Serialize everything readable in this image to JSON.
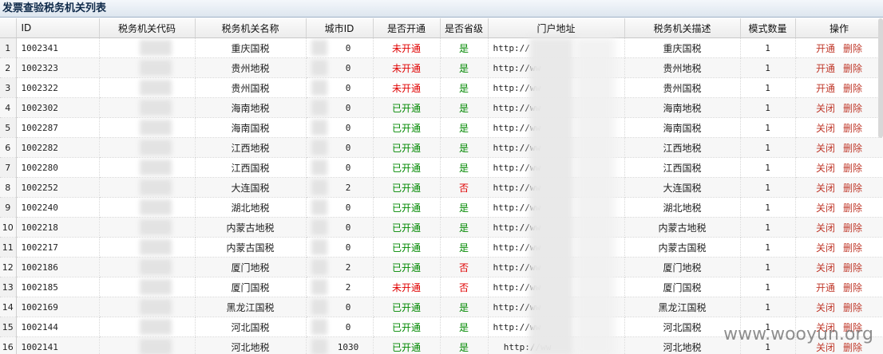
{
  "panel": {
    "title": "发票查验税务机关列表"
  },
  "columns": {
    "id": "ID",
    "code": "税务机关代码",
    "name": "税务机关名称",
    "city_id": "城市ID",
    "enabled": "是否开通",
    "provincial": "是否省级",
    "portal": "门户地址",
    "description": "税务机关描述",
    "mode_count": "模式数量",
    "actions": "操作"
  },
  "labels": {
    "delete": "删除"
  },
  "colors": {
    "not_open": "#e00000",
    "open": "#008800",
    "action": "#c0392b"
  },
  "rows": [
    {
      "no": "1",
      "id": "1002341",
      "code": "",
      "name": "重庆国税",
      "city": "0",
      "enabled": "未开通",
      "prov": "是",
      "url": "http://                  ov    /",
      "desc": "重庆国税",
      "modes": "1",
      "toggle": "开通"
    },
    {
      "no": "2",
      "id": "1002323",
      "code": "",
      "name": "贵州地税",
      "city": "0",
      "enabled": "未开通",
      "prov": "是",
      "url": "http://ww                      .",
      "desc": "贵州地税",
      "modes": "1",
      "toggle": "开通"
    },
    {
      "no": "3",
      "id": "1002322",
      "code": "",
      "name": "贵州国税",
      "city": "0",
      "enabled": "未开通",
      "prov": "是",
      "url": "http://ww                      /",
      "desc": "贵州国税",
      "modes": "1",
      "toggle": "开通"
    },
    {
      "no": "4",
      "id": "1002302",
      "code": "",
      "name": "海南地税",
      "city": "0",
      "enabled": "已开通",
      "prov": "是",
      "url": "http://ww                      e",
      "desc": "海南地税",
      "modes": "1",
      "toggle": "关闭"
    },
    {
      "no": "5",
      "id": "1002287",
      "code": "",
      "name": "海南国税",
      "city": "0",
      "enabled": "已开通",
      "prov": "是",
      "url": "http://ww                      r",
      "desc": "海南国税",
      "modes": "1",
      "toggle": "关闭"
    },
    {
      "no": "6",
      "id": "1002282",
      "code": "",
      "name": "江西地税",
      "city": "0",
      "enabled": "已开通",
      "prov": "是",
      "url": "http://ww                      t",
      "desc": "江西地税",
      "modes": "1",
      "toggle": "关闭"
    },
    {
      "no": "7",
      "id": "1002280",
      "code": "",
      "name": "江西国税",
      "city": "0",
      "enabled": "已开通",
      "prov": "是",
      "url": "http://ww                      /",
      "desc": "江西国税",
      "modes": "1",
      "toggle": "关闭"
    },
    {
      "no": "8",
      "id": "1002252",
      "code": "",
      "name": "大连国税",
      "city": "2",
      "enabled": "已开通",
      "prov": "否",
      "url": "http://ww                      /",
      "desc": "大连国税",
      "modes": "1",
      "toggle": "关闭"
    },
    {
      "no": "9",
      "id": "1002240",
      "code": "",
      "name": "湖北地税",
      "city": "0",
      "enabled": "已开通",
      "prov": "是",
      "url": "http://ww                      /",
      "desc": "湖北地税",
      "modes": "1",
      "toggle": "关闭"
    },
    {
      "no": "10",
      "id": "1002218",
      "code": "",
      "name": "内蒙古地税",
      "city": "0",
      "enabled": "已开通",
      "prov": "是",
      "url": "http://ww                      /",
      "desc": "内蒙古地税",
      "modes": "1",
      "toggle": "关闭"
    },
    {
      "no": "11",
      "id": "1002217",
      "code": "",
      "name": "内蒙古国税",
      "city": "0",
      "enabled": "已开通",
      "prov": "是",
      "url": "http://ww                      /",
      "desc": "内蒙古国税",
      "modes": "1",
      "toggle": "关闭"
    },
    {
      "no": "12",
      "id": "1002186",
      "code": "",
      "name": "厦门地税",
      "city": "2",
      "enabled": "已开通",
      "prov": "否",
      "url": "http://ww                      /",
      "desc": "厦门地税",
      "modes": "1",
      "toggle": "关闭"
    },
    {
      "no": "13",
      "id": "1002185",
      "code": "",
      "name": "厦门国税",
      "city": "2",
      "enabled": "未开通",
      "prov": "否",
      "url": "http://ww                      /",
      "desc": "厦门国税",
      "modes": "1",
      "toggle": "开通"
    },
    {
      "no": "14",
      "id": "1002169",
      "code": "",
      "name": "黑龙江国税",
      "city": "0",
      "enabled": "已开通",
      "prov": "是",
      "url": "http://ww                      /",
      "desc": "黑龙江国税",
      "modes": "1",
      "toggle": "关闭"
    },
    {
      "no": "15",
      "id": "1002144",
      "code": "",
      "name": "河北国税",
      "city": "0",
      "enabled": "已开通",
      "prov": "是",
      "url": "http://ww                      /",
      "desc": "河北国税",
      "modes": "1",
      "toggle": "关闭"
    },
    {
      "no": "16",
      "id": "1002141",
      "code": "",
      "name": "河北地税",
      "city": "1030",
      "enabled": "已开通",
      "prov": "是",
      "url": "  http://ww                    /",
      "desc": "河北地税",
      "modes": "1",
      "toggle": "关闭"
    }
  ],
  "watermark": "www.wooyun.org"
}
